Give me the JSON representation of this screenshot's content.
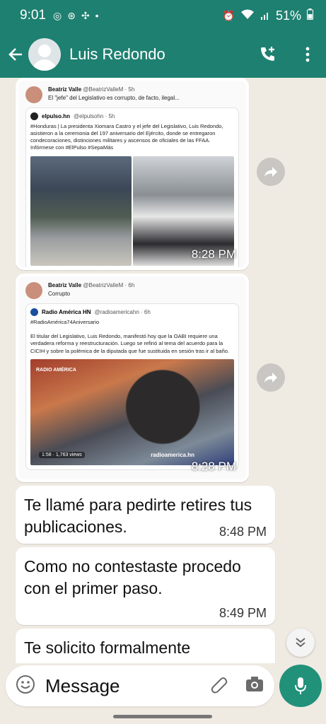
{
  "status": {
    "time": "9:01",
    "battery": "51%"
  },
  "header": {
    "contact_name": "Luis Redondo"
  },
  "images": [
    {
      "author_name": "Beatriz Valle",
      "author_handle": "@BeatrizValleM · 5h",
      "text": "El \"jefe\" del Legislativo es corrupto, de facto, ilegal...",
      "quote_name": "elpulso.hn",
      "quote_handle": "@elpulsohn · 5h",
      "quote_text": "#Honduras | La presidenta Xiomara Castro y el jefe del Legislativo, Luis Redondo, asistieron a la ceremonia del 197 aniversario del Ejército, donde se entregaron condecoraciones, distinciones militares y ascensos de oficiales de las FFAA. Infórmese con #ElPulso #SepaMás",
      "time": "8:28 PM"
    },
    {
      "author_name": "Beatriz Valle",
      "author_handle": "@BeatrizValleM · 6h",
      "text": "Corrupto",
      "quote_name": "Radio América HN",
      "quote_handle": "@radioamericahn · 6h",
      "quote_text": "#RadioAmérica74Aniversario\n\nEl titular del Legislativo, Luis Redondo, manifestó hoy que la OABI requiere una verdadera reforma y reestructuración. Luego se refirió al tema del acuerdo para la CICIH y sobre la polémica de la diputada que fue sustituida en sesión tras ir al baño.",
      "video_stats": "1:58 · 1,763 views",
      "news_tag": "RADIO AMÉRICA",
      "news_foot": "radioamerica.hn",
      "time": "8:28 PM"
    }
  ],
  "messages": [
    {
      "text": "Te llamé para pedirte retires tus publicaciones.",
      "time": "8:48 PM"
    },
    {
      "text": "Como no contestaste procedo con el primer paso.",
      "time": "8:49 PM"
    },
    {
      "text": "Te solicito formalmente",
      "time": ""
    }
  ],
  "input": {
    "placeholder": "Message"
  },
  "colors": {
    "header": "#1e8070",
    "mic": "#21917a",
    "background": "#efeae2"
  }
}
